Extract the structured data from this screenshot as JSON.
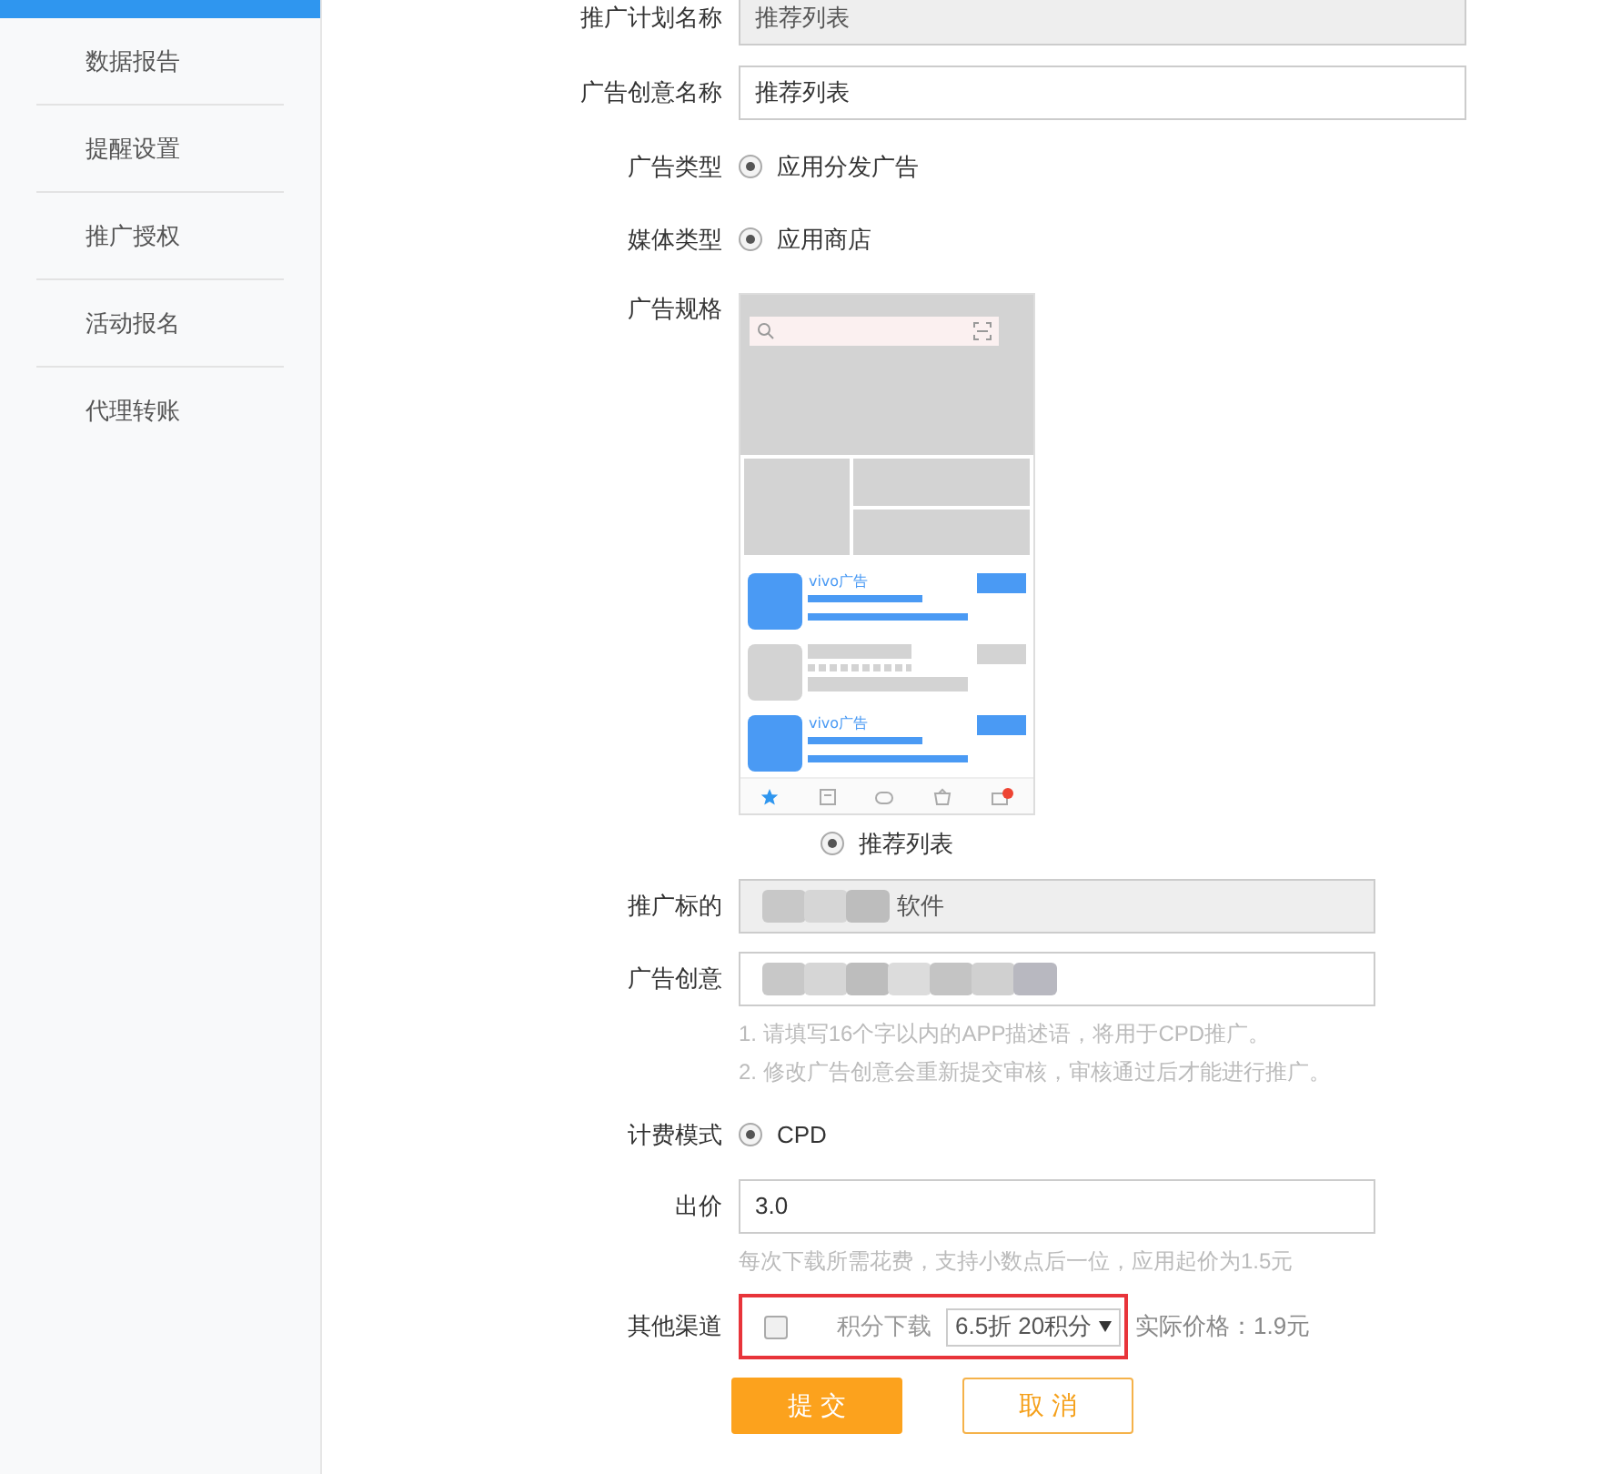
{
  "sidebar": {
    "items": [
      {
        "label": "数据报告",
        "selected": false
      },
      {
        "label": "提醒设置",
        "selected": false
      },
      {
        "label": "推广授权",
        "selected": false
      },
      {
        "label": "活动报名",
        "selected": false
      },
      {
        "label": "代理转账",
        "selected": false
      }
    ]
  },
  "form": {
    "fields": [
      {
        "kind": "text",
        "label": "推广计划名称",
        "value": "推荐列表",
        "disabled": true,
        "wide": true
      },
      {
        "kind": "text",
        "label": "广告创意名称",
        "value": "推荐列表",
        "disabled": false,
        "wide": true
      },
      {
        "kind": "radio",
        "label": "广告类型",
        "options": [
          {
            "label": "应用分发广告",
            "selected": true
          }
        ]
      },
      {
        "kind": "radio",
        "label": "媒体类型",
        "options": [
          {
            "label": "应用商店",
            "selected": true
          }
        ]
      },
      {
        "kind": "spec",
        "label": "广告规格",
        "ad_labels": [
          "vivo广告",
          "vivo广告"
        ],
        "options": [
          {
            "label": "推荐列表",
            "selected": true
          }
        ]
      },
      {
        "kind": "text",
        "label": "推广标的",
        "value": "软件",
        "disabled": true,
        "blurred": true,
        "wide": false
      },
      {
        "kind": "text",
        "label": "广告创意",
        "disabled": false,
        "blurred": true,
        "wide": false,
        "hints": [
          "1. 请填写16个字以内的APP描述语，将用于CPD推广。",
          "2. 修改广告创意会重新提交审核，审核通过后才能进行推广。"
        ]
      },
      {
        "kind": "radio",
        "label": "计费模式",
        "options": [
          {
            "label": "CPD",
            "selected": true
          }
        ]
      },
      {
        "kind": "text",
        "label": "出价",
        "value": "3.0",
        "disabled": false,
        "wide": false,
        "hints": [
          "每次下载所需花费，支持小数点后一位，应用起价为1.5元"
        ]
      },
      {
        "kind": "channel",
        "label": "其他渠道",
        "checked": false,
        "highlighted": true,
        "option_label": "积分下载",
        "select_value": "6.5折 20积分",
        "price": "实际价格：1.9元"
      }
    ]
  },
  "buttons": [
    {
      "label": "提 交",
      "kind": "primary"
    },
    {
      "label": "取 消",
      "kind": "secondary"
    }
  ]
}
